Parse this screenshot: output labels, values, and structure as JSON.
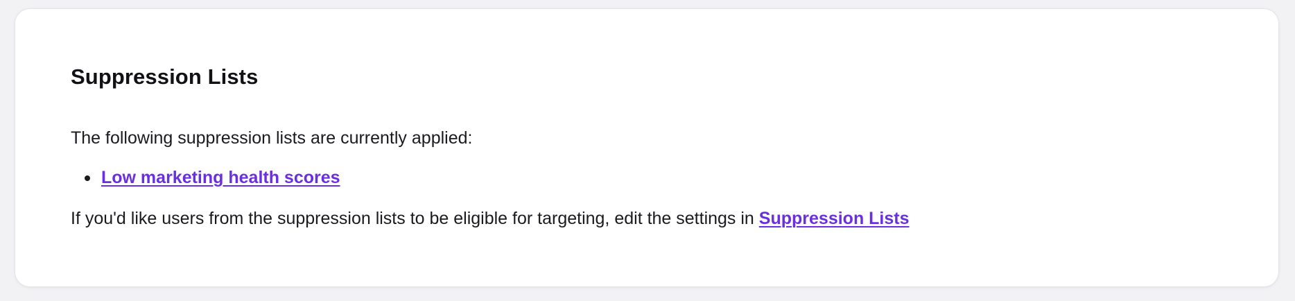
{
  "panel": {
    "title": "Suppression Lists",
    "intro": "The following suppression lists are currently applied:",
    "applied_lists": [
      {
        "label": "Low marketing health scores"
      }
    ],
    "footer_text": "If you'd like users from the suppression lists to be eligible for targeting, edit the settings in ",
    "settings_link": "Suppression Lists"
  },
  "colors": {
    "link": "#6a2fe0",
    "card_background": "#ffffff",
    "page_background": "#f2f2f5",
    "text": "#1a1a1f"
  }
}
